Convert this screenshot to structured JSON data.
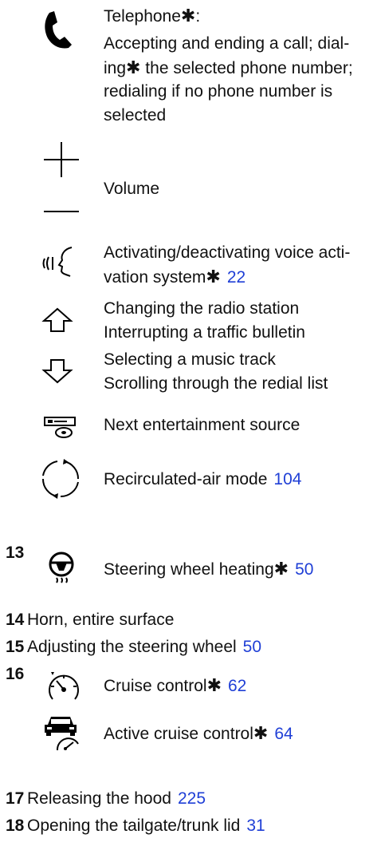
{
  "telephone": {
    "title": "Telephone",
    "title_star": "✱",
    "title_colon": ":",
    "desc_line1": "Accepting and ending a call; dial-",
    "desc_line2a": "ing",
    "desc_line2_star": "✱",
    "desc_line2b": " the selected phone number;",
    "desc_line3": "redialing if no phone number is",
    "desc_line4": "selected"
  },
  "volume": {
    "label": "Volume"
  },
  "voice": {
    "line1": "Activating/deactivating voice acti-",
    "line2": "vation system",
    "star": "✱",
    "page": "22"
  },
  "arrows": {
    "line1": "Changing the radio station",
    "line2": "Interrupting a traffic bulletin",
    "line3": "Selecting a music track",
    "line4": "Scrolling through the redial list"
  },
  "entertainment": {
    "label": "Next entertainment source"
  },
  "recirc": {
    "label": "Recirculated-air mode",
    "page": "104"
  },
  "items": [
    {
      "num": "13",
      "label": "Steering wheel heating",
      "star": "✱",
      "page": "50"
    },
    {
      "num": "14",
      "label": "Horn, entire surface"
    },
    {
      "num": "15",
      "label": "Adjusting the steering wheel",
      "page": "50"
    },
    {
      "num": "16",
      "label": "Cruise control",
      "star": "✱",
      "page": "62"
    },
    {
      "label": "Active cruise control",
      "star": "✱",
      "page": "64"
    },
    {
      "num": "17",
      "label": "Releasing the hood",
      "page": "225"
    },
    {
      "num": "18",
      "label": "Opening the tailgate/trunk lid",
      "page": "31"
    }
  ],
  "icons": [
    "phone-icon",
    "plus-icon",
    "minus-icon",
    "voice-icon",
    "arrow-up-icon",
    "arrow-down-icon",
    "media-source-icon",
    "recirculation-icon",
    "steering-heat-icon",
    "speedometer-icon",
    "active-cruise-icon"
  ]
}
